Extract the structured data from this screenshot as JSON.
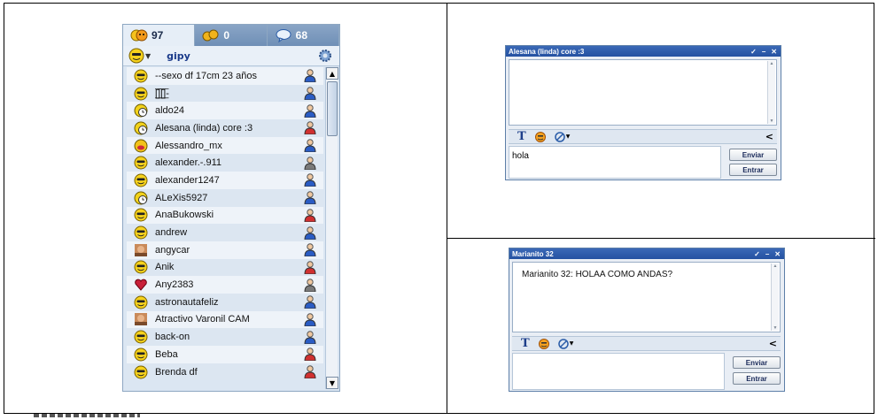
{
  "contact_list": {
    "tabs": [
      {
        "icon": "friends-icon",
        "count": "97"
      },
      {
        "icon": "group-icon",
        "count": "0"
      },
      {
        "icon": "chat-bubble-icon",
        "count": "68"
      }
    ],
    "user": {
      "name": "gipy",
      "status_icon": "smiley-icon",
      "settings_icon": "gear-icon"
    },
    "contacts": [
      {
        "name": "--sexo df 17cm 23 años",
        "avatar": "smiley",
        "gender": "male"
      },
      {
        "name": "[̲̅]̲̅[̲̅]̲̅-",
        "avatar": "smiley",
        "gender": "male"
      },
      {
        "name": "aldo24",
        "avatar": "clock",
        "gender": "male"
      },
      {
        "name": "Alesana (linda) core :3",
        "avatar": "clock",
        "gender": "female"
      },
      {
        "name": "Alessandro_mx",
        "avatar": "lips",
        "gender": "male"
      },
      {
        "name": "alexander.-.911",
        "avatar": "smiley",
        "gender": "offline"
      },
      {
        "name": "alexander1247",
        "avatar": "smiley",
        "gender": "male"
      },
      {
        "name": "ALeXis5927",
        "avatar": "clock",
        "gender": "male"
      },
      {
        "name": "AnaBukowski",
        "avatar": "smiley",
        "gender": "female"
      },
      {
        "name": "andrew",
        "avatar": "smiley",
        "gender": "male"
      },
      {
        "name": "angycar",
        "avatar": "photo",
        "gender": "male"
      },
      {
        "name": "Anik",
        "avatar": "smiley",
        "gender": "female"
      },
      {
        "name": "Any2383",
        "avatar": "heart",
        "gender": "offline"
      },
      {
        "name": "astronautafeliz",
        "avatar": "smiley",
        "gender": "male"
      },
      {
        "name": "Atractivo Varonil CAM",
        "avatar": "photo",
        "gender": "male"
      },
      {
        "name": "back-on",
        "avatar": "smiley",
        "gender": "male"
      },
      {
        "name": "Beba",
        "avatar": "smiley",
        "gender": "female"
      },
      {
        "name": "Brenda df",
        "avatar": "smiley",
        "gender": "female"
      }
    ]
  },
  "chat_top": {
    "title": "Alesana (linda) core :3",
    "controls": [
      "✓",
      "–",
      "✕"
    ],
    "messages": [],
    "input_value": "hola",
    "send_label": "Enviar",
    "enter_label": "Entrar",
    "collapse": "<"
  },
  "chat_bottom": {
    "title": "Marianito 32",
    "controls": [
      "✓",
      "–",
      "✕"
    ],
    "messages": [
      "Marianito 32: HOLAA COMO ANDAS?"
    ],
    "input_value": "",
    "send_label": "Enviar",
    "enter_label": "Entrar",
    "collapse": "<"
  },
  "colors": {
    "titlebar": "#2c5aa8",
    "panel": "#dbe6f2",
    "male": "#2a5cc4",
    "female": "#d03030"
  }
}
